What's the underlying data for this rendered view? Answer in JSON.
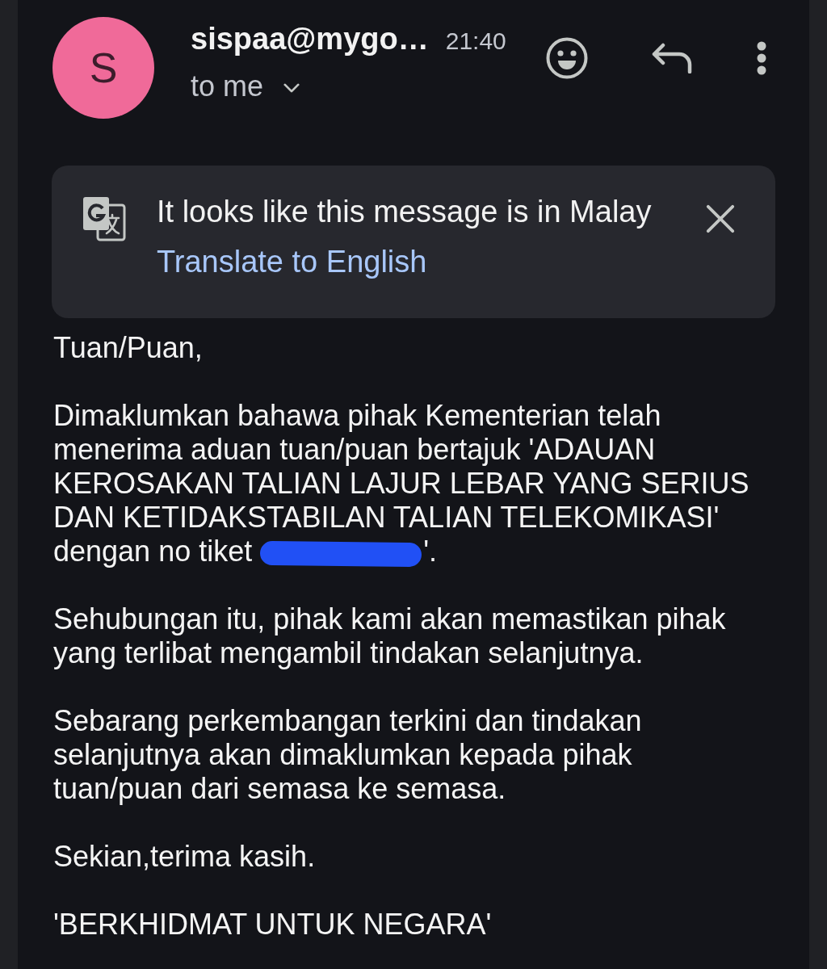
{
  "message_header": {
    "avatar_letter": "S",
    "sender": "sispaa@mygo…",
    "time": "21:40",
    "recipient": "to me"
  },
  "translate_banner": {
    "message": "It looks like this message is in Malay",
    "action": "Translate to English"
  },
  "body": {
    "paragraphs": [
      {
        "text": "Tuan/Puan,",
        "redacted": false
      },
      {
        "text": "Dimaklumkan bahawa pihak Kementerian telah menerima aduan tuan/puan bertajuk 'ADAUAN KEROSAKAN TALIAN LAJUR LEBAR YANG SERIUS DAN KETIDAKSTABILAN TALIAN TELEKOMIKASI' dengan no tiket",
        "redacted": true,
        "text_after": "'."
      },
      {
        "text": "Sehubungan itu, pihak kami akan memastikan pihak yang terlibat mengambil tindakan selanjutnya.",
        "redacted": false
      },
      {
        "text": "Sebarang perkembangan terkini dan tindakan selanjutnya akan dimaklumkan kepada pihak tuan/puan dari semasa ke semasa.",
        "redacted": false
      },
      {
        "text": "Sekian,terima kasih.",
        "redacted": false
      },
      {
        "text": "'BERKHIDMAT UNTUK NEGARA'",
        "redacted": false
      }
    ]
  }
}
